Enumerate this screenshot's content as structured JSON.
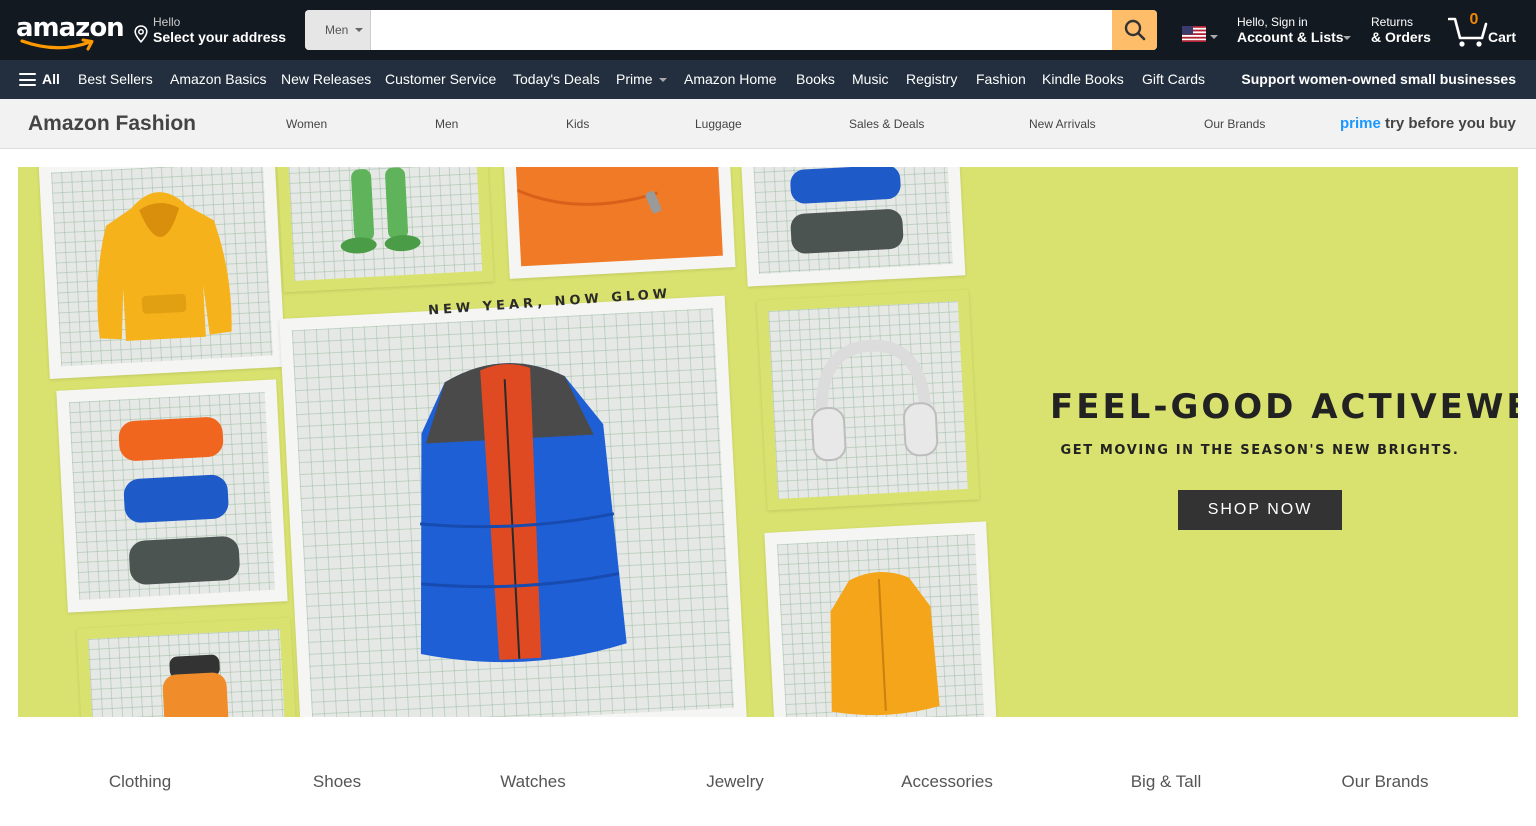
{
  "header": {
    "logo_alt": "amazon",
    "address": {
      "hello": "Hello",
      "label": "Select your address"
    },
    "search": {
      "department": "Men",
      "placeholder": ""
    },
    "account": {
      "line1": "Hello, Sign in",
      "line2": "Account & Lists"
    },
    "returns": {
      "line1": "Returns",
      "line2": "& Orders"
    },
    "cart": {
      "count": "0",
      "label": "Cart"
    }
  },
  "subnav": {
    "all_label": "All",
    "items": [
      "Best Sellers",
      "Amazon Basics",
      "New Releases",
      "Customer Service",
      "Today's Deals",
      "Prime",
      "Amazon Home",
      "Books",
      "Music",
      "Registry",
      "Fashion",
      "Kindle Books",
      "Gift Cards"
    ],
    "promo": "Support women-owned small businesses"
  },
  "fashion": {
    "title": "Amazon Fashion",
    "nav": [
      "Women",
      "Men",
      "Kids",
      "Luggage",
      "Sales & Deals",
      "New Arrivals",
      "Our Brands"
    ],
    "prime_word": "prime",
    "prime_tagline": "try before you buy"
  },
  "hero": {
    "overlay_text": "NEW YEAR, NOW GLOW",
    "title": "FEEL-GOOD ACTIVEWEAR",
    "subtitle": "GET MOVING IN THE SEASON'S NEW BRIGHTS.",
    "cta": "SHOP NOW",
    "background_color": "#d9e26e"
  },
  "categories": [
    "Clothing",
    "Shoes",
    "Watches",
    "Jewelry",
    "Accessories",
    "Big & Tall",
    "Our Brands"
  ],
  "colors": {
    "nav_dark": "#131921",
    "subnav": "#232f3e",
    "search_button": "#febd69",
    "cart_count": "#f08804",
    "prime_blue": "#1a98ff"
  }
}
